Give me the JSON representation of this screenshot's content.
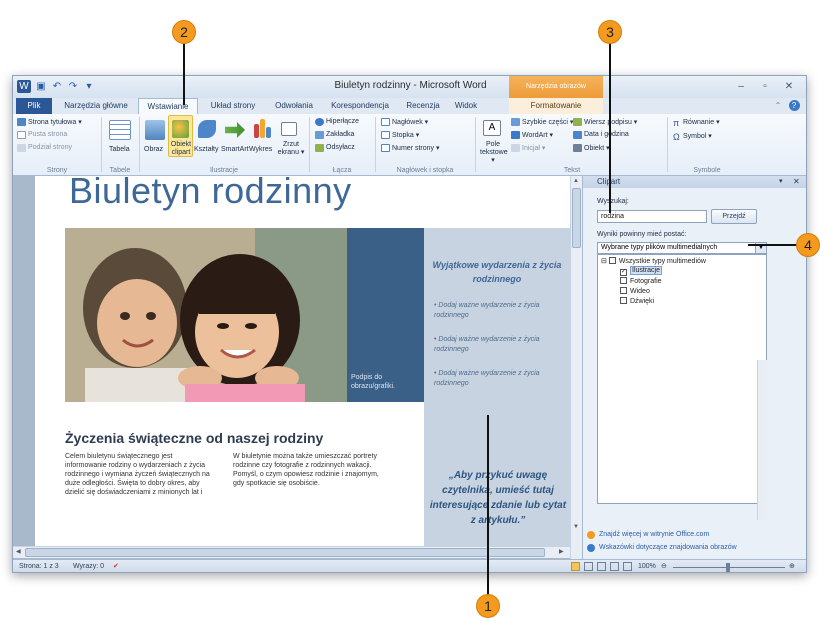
{
  "window": {
    "title": "Biuletyn rodzinny - Microsoft Word",
    "context_tools": "Narzędzia obrazów",
    "minimize": "‒",
    "maximize": "▫",
    "close": "✕"
  },
  "quick_access": [
    "W",
    "💾",
    "↶",
    "↷",
    "▾"
  ],
  "tabs": [
    {
      "label": "Plik"
    },
    {
      "label": "Narzędzia główne"
    },
    {
      "label": "Wstawianie"
    },
    {
      "label": "Układ strony"
    },
    {
      "label": "Odwołania"
    },
    {
      "label": "Korespondencja"
    },
    {
      "label": "Recenzja"
    },
    {
      "label": "Widok"
    },
    {
      "label": "Formatowanie"
    }
  ],
  "ribbon": {
    "pages": {
      "items": [
        "Strona tytułowa ▾",
        "Pusta strona",
        "Podział strony"
      ],
      "group": "Strony"
    },
    "tables": {
      "items": [
        "Tabela"
      ],
      "group": "Tabele"
    },
    "illustrations": {
      "items": [
        "Obraz",
        "Obiekt clipart",
        "Kształty",
        "SmartArt",
        "Wykres",
        "Zrzut ekranu ▾"
      ],
      "group": "Ilustracje"
    },
    "links": {
      "items": [
        "Hiperłącze",
        "Zakładka",
        "Odsyłacz"
      ],
      "group": "Łącza"
    },
    "header_footer": {
      "items": [
        "Nagłówek ▾",
        "Stopka ▾",
        "Numer strony ▾"
      ],
      "group": "Nagłówek i stopka"
    },
    "text": {
      "items": [
        "Pole tekstowe ▾",
        "Szybkie części ▾",
        "WordArt ▾",
        "Inicjał ▾",
        "Wiersz podpisu ▾",
        "Data i godzina",
        "Obiekt ▾"
      ],
      "group": "Tekst"
    },
    "symbols": {
      "items": [
        "Równanie ▾",
        "Symbol ▾"
      ],
      "group": "Symbole"
    }
  },
  "document": {
    "title": "Biuletyn rodzinny",
    "photo_caption": "Podpis do obrazu/grafiki.",
    "sidebar_heading": "Wyjątkowe wydarzenia z życia rodzinnego",
    "bullets": [
      "Dodaj ważne wydarzenie z życia rodzinnego",
      "Dodaj ważne wydarzenie z życia rodzinnego",
      "Dodaj ważne wydarzenie z życia rodzinnego"
    ],
    "section_title": "Życzenia świąteczne od naszej rodziny",
    "col1": "Celem biuletynu świątecznego jest informowanie rodziny o wydarzeniach z życia rodzinnego i wymiana życzeń świątecznych na duże odległości. Święta to dobry okres, aby dzielić się doświadczeniami z minionych lat i",
    "col2": "W biuletynie można także umieszczać portrety rodzinne czy fotografie z rodzinnych wakacji. Pomyśl, o czym opowiesz rodzinie i znajomym, gdy spotkacie się osobiście.",
    "quote": "„Aby przykuć uwagę czytelnika, umieść tutaj interesujące zdanie lub cytat z artykułu.”"
  },
  "clipart": {
    "pane_title": "Clipart",
    "search_label": "Wyszukaj:",
    "search_value": "rodzina",
    "search_button": "Przejdź",
    "results_label": "Wyniki powinny mieć postać:",
    "type_value": "Wybrane typy plików multimedialnych",
    "tree": [
      {
        "label": "Wszystkie typy multimediów",
        "checked": false
      },
      {
        "label": "Ilustracje",
        "checked": true
      },
      {
        "label": "Fotografie",
        "checked": false
      },
      {
        "label": "Wideo",
        "checked": false
      },
      {
        "label": "Dźwięki",
        "checked": false
      }
    ],
    "link_more": "Znajdź więcej w witrynie Office.com",
    "link_hints": "Wskazówki dotyczące znajdowania obrazów"
  },
  "status": {
    "page": "Strona: 1 z 3",
    "words": "Wyrazy: 0",
    "zoom": "100%"
  },
  "callouts": [
    "1",
    "2",
    "3",
    "4"
  ]
}
